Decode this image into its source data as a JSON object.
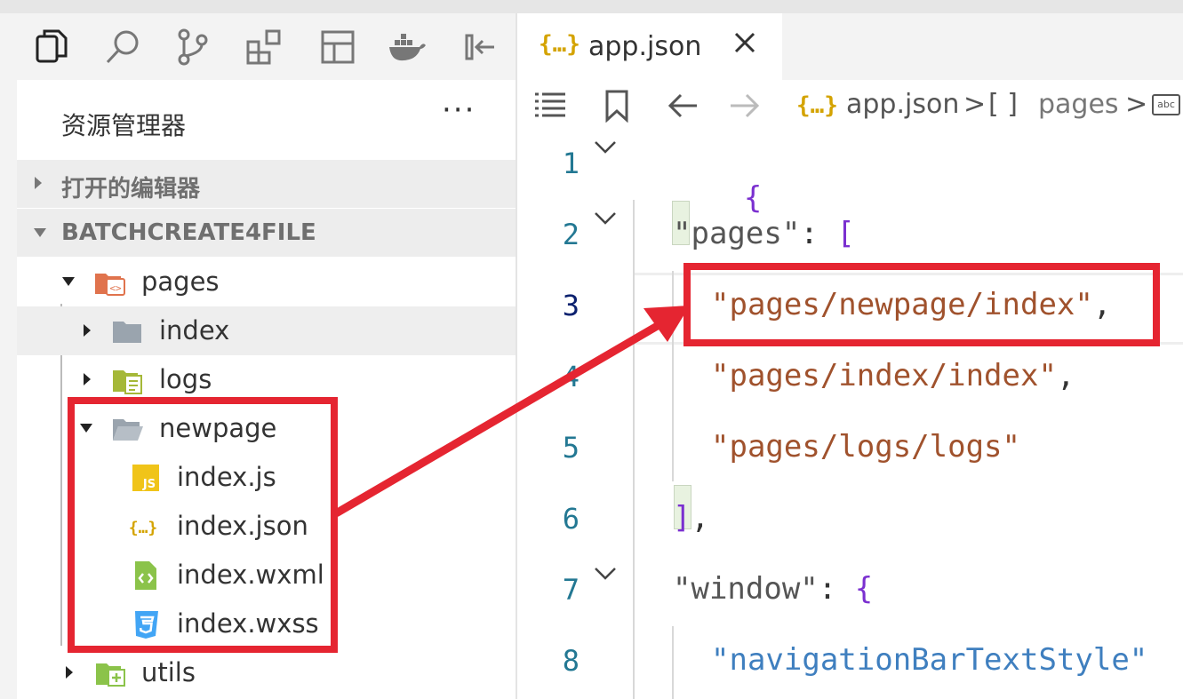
{
  "activity_bar": {
    "icons": [
      "explorer-icon",
      "search-icon",
      "source-control-icon",
      "extensions-icon",
      "layout-icon",
      "docker-icon",
      "collapse-panel-icon"
    ]
  },
  "explorer": {
    "title": "资源管理器",
    "more": "···",
    "sections": [
      {
        "label": "打开的编辑器",
        "expanded": false
      },
      {
        "label": "BATCHCREATE4FILE",
        "expanded": true
      }
    ],
    "tree": [
      {
        "name": "pages",
        "type": "folder-pages",
        "expanded": true
      },
      {
        "name": "index",
        "type": "folder",
        "expanded": false
      },
      {
        "name": "logs",
        "type": "folder-logs",
        "expanded": false
      },
      {
        "name": "newpage",
        "type": "folder-open",
        "expanded": true
      },
      {
        "name": "index.js",
        "type": "file-js"
      },
      {
        "name": "index.json",
        "type": "file-json"
      },
      {
        "name": "index.wxml",
        "type": "file-wxml"
      },
      {
        "name": "index.wxss",
        "type": "file-wxss"
      },
      {
        "name": "utils",
        "type": "folder-utils",
        "expanded": false
      }
    ]
  },
  "editor": {
    "tab": {
      "icon": "{…}",
      "label": "app.json"
    },
    "breadcrumb": {
      "file_icon": "{…}",
      "file": "app.json",
      "sep": ">",
      "array_icon": "[ ]",
      "array": "pages",
      "string_icon": "abc"
    },
    "lines": [
      {
        "num": "1",
        "tokens": [
          {
            "t": "{",
            "c": "p-brace"
          }
        ]
      },
      {
        "num": "2",
        "tokens": [
          {
            "t": "\"pages\"",
            "c": "p-key"
          },
          {
            "t": ": ",
            "c": "p-punc"
          },
          {
            "t": "[",
            "c": "p-brace"
          }
        ]
      },
      {
        "num": "3",
        "tokens": [
          {
            "t": "\"pages/newpage/index\"",
            "c": "p-str"
          },
          {
            "t": ",",
            "c": "p-punc"
          }
        ]
      },
      {
        "num": "4",
        "tokens": [
          {
            "t": "\"pages/index/index\"",
            "c": "p-str"
          },
          {
            "t": ",",
            "c": "p-punc"
          }
        ]
      },
      {
        "num": "5",
        "tokens": [
          {
            "t": "\"pages/logs/logs\"",
            "c": "p-str"
          }
        ]
      },
      {
        "num": "6",
        "tokens": [
          {
            "t": "]",
            "c": "p-brace"
          },
          {
            "t": ",",
            "c": "p-punc"
          }
        ]
      },
      {
        "num": "7",
        "tokens": [
          {
            "t": "\"window\"",
            "c": "p-key"
          },
          {
            "t": ": ",
            "c": "p-punc"
          },
          {
            "t": "{",
            "c": "p-brace"
          }
        ]
      },
      {
        "num": "8",
        "tokens": [
          {
            "t": "\"navigationBarTextStyle\"",
            "c": "p-str2"
          }
        ]
      }
    ]
  },
  "colors": {
    "highlight": "#e52531",
    "line_number": "#237893",
    "string": "#a0522d",
    "bracket": "#7b30d0",
    "json_icon": "#d4a300"
  }
}
